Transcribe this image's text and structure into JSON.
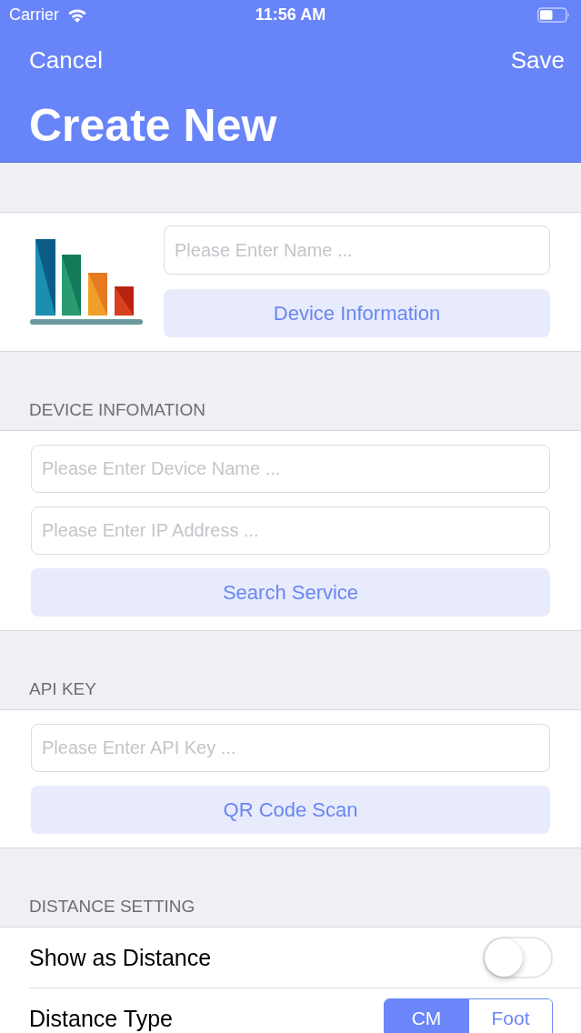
{
  "status_bar": {
    "carrier": "Carrier",
    "time": "11:56 AM"
  },
  "nav_bar": {
    "left_button": "Cancel",
    "right_button": "Save",
    "title": "Create New"
  },
  "profile": {
    "name_field": {
      "placeholder": "Please Enter Name ..."
    },
    "button": "Device Information"
  },
  "sections": [
    {
      "header": "DEVICE INFOMATION",
      "kind": "form",
      "items": [
        {
          "kind": "field",
          "placeholder": "Please Enter Device Name ..."
        },
        {
          "kind": "field",
          "placeholder": "Please Enter IP Address ..."
        },
        {
          "kind": "button",
          "label": "Search Service"
        }
      ]
    },
    {
      "header": "API KEY",
      "kind": "form",
      "items": [
        {
          "kind": "field",
          "placeholder": "Please Enter API Key ..."
        },
        {
          "kind": "button",
          "label": "QR Code Scan"
        }
      ]
    },
    {
      "header": "DISTANCE SETTING",
      "kind": "list",
      "items": [
        {
          "kind": "toggle",
          "label": "Show as Distance",
          "on": false
        },
        {
          "kind": "segmented",
          "label": "Distance Type",
          "options": [
            {
              "label": "CM",
              "selected": true
            },
            {
              "label": "Foot",
              "selected": false
            }
          ]
        }
      ]
    }
  ]
}
